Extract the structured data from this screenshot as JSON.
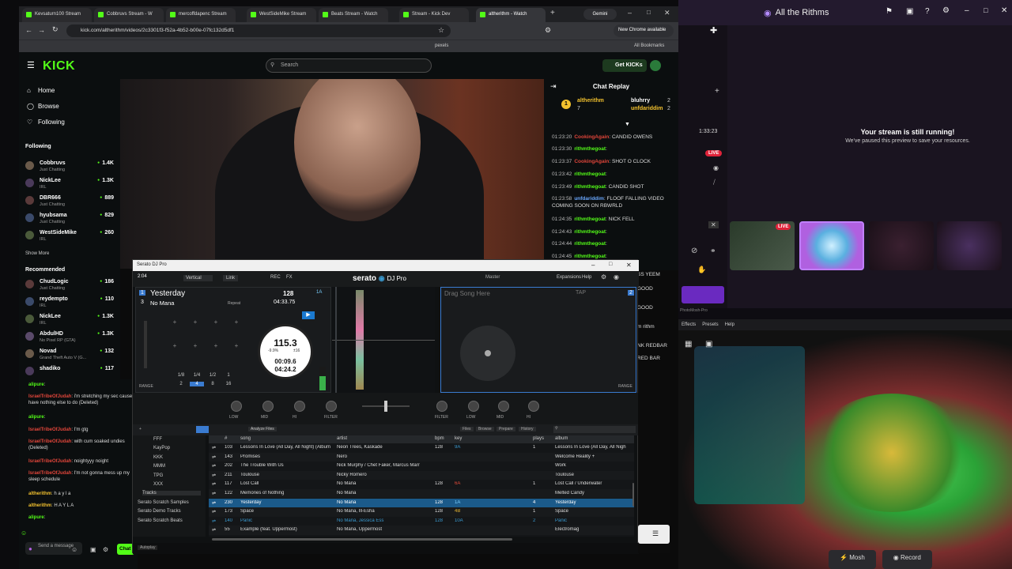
{
  "browser": {
    "tabs": [
      "Kevsaturn100 Stream",
      "Cobbruvs Stream - W",
      "mercoffdapenc Stream",
      "WestSideMike Stream",
      "Beats Stream - Watch",
      "Stream - Kick Dev",
      "altherithm - Watch"
    ],
    "gemini": "Gemini",
    "url": "kick.com/altherithm/videos/2c3301f3-f52a-4b52-b00e-07fc132d5df1",
    "new_chrome": "New Chrome available",
    "all_bookmarks": "All Bookmarks",
    "bm_pexels": "pexels"
  },
  "kick": {
    "logo": "KICK",
    "search_placeholder": "Search",
    "get_kicks": "Get KICKs",
    "nav": {
      "home": "Home",
      "browse": "Browse",
      "following": "Following"
    },
    "following_title": "Following",
    "following": [
      {
        "name": "Cobbruvs",
        "cat": "Just Chatting",
        "viewers": "1.4K"
      },
      {
        "name": "NickLee",
        "cat": "IRL",
        "viewers": "1.3K"
      },
      {
        "name": "DBR666",
        "cat": "Just Chatting",
        "viewers": "889"
      },
      {
        "name": "hyubsama",
        "cat": "Just Chatting",
        "viewers": "829"
      },
      {
        "name": "WestSideMike",
        "cat": "IRL",
        "viewers": "260"
      }
    ],
    "show_more": "Show More",
    "recommended_title": "Recommended",
    "recommended": [
      {
        "name": "ChudLogic",
        "cat": "Just Chatting",
        "viewers": "186"
      },
      {
        "name": "reydempto",
        "cat": "IRL",
        "viewers": "110"
      },
      {
        "name": "NickLee",
        "cat": "IRL",
        "viewers": "1.3K"
      },
      {
        "name": "AbdulHD",
        "cat": "No Pixel RP (GTA)",
        "viewers": "1.3K"
      },
      {
        "name": "Novad",
        "cat": "Grand Theft Auto V (G...",
        "viewers": "132"
      },
      {
        "name": "shadiko",
        "cat": "",
        "viewers": "117"
      }
    ],
    "chat_replay_title": "Chat Replay",
    "pinned": {
      "rank": "1",
      "user": "altherithm",
      "count": "7",
      "user2": "bluhrry",
      "count2": "2",
      "user3": "unfdariddim",
      "count3": "2"
    },
    "chat": [
      {
        "ts": "01:23:20",
        "user": "CookingAgain",
        "color": "#e0453a",
        "text": ": CANDID OWENS"
      },
      {
        "ts": "01:23:30",
        "user": "rithmthegoat",
        "color": "#53fc18",
        "text": ":"
      },
      {
        "ts": "01:23:37",
        "user": "CookingAgain",
        "color": "#e0453a",
        "text": ": SHOT O CLOCK"
      },
      {
        "ts": "01:23:42",
        "user": "rithmthegoat",
        "color": "#53fc18",
        "text": ":"
      },
      {
        "ts": "01:23:49",
        "user": "rithmthegoat",
        "color": "#53fc18",
        "text": ": CANDID SHOT"
      },
      {
        "ts": "01:23:58",
        "user": "unfdariddim",
        "color": "#6aa8ff",
        "text": ": FLOOF FALLING VIDEO COMING SOON ON RBWRLD"
      },
      {
        "ts": "01:24:35",
        "user": "rithmthegoat",
        "color": "#53fc18",
        "text": ": NICK FELL"
      },
      {
        "ts": "01:24:43",
        "user": "rithmthegoat",
        "color": "#53fc18",
        "text": ":"
      },
      {
        "ts": "01:24:44",
        "user": "rithmthegoat",
        "color": "#53fc18",
        "text": ":"
      },
      {
        "ts": "01:24:45",
        "user": "rithmthegoat",
        "color": "#53fc18",
        "text": ":"
      }
    ],
    "chat_overflow": [
      "SS YEEM",
      "GOOD",
      "GOOD",
      "m rithm",
      "NK REDBAR",
      "RED BAR"
    ],
    "chat2": [
      {
        "user": "alipure",
        "color": "#53fc18",
        "text": ":"
      },
      {
        "user": "IsraelTribeOfJudah",
        "color": "#e0453a",
        "text": ": i'm stretching my sec cause I have nothing else to do (Deleted)"
      },
      {
        "user": "alipure",
        "color": "#53fc18",
        "text": ":"
      },
      {
        "user": "IsraelTribeOfJudah",
        "color": "#e0453a",
        "text": ": I'm gtg"
      },
      {
        "user": "IsraelTribeOfJudah",
        "color": "#e0453a",
        "text": ": with cum soaked undies (Deleted)"
      },
      {
        "user": "IsraelTribeOfJudah",
        "color": "#e0453a",
        "text": ": noightyyy noight"
      },
      {
        "user": "IsraelTribeOfJudah",
        "color": "#e0453a",
        "text": ": I'm not gonna mess up my sleep schedule"
      },
      {
        "user": "altherithm",
        "color": "#f2c12e",
        "text": ": h a y l a"
      },
      {
        "user": "altherithm",
        "color": "#f2c12e",
        "text": ": H A Y L A"
      },
      {
        "user": "alipure",
        "color": "#53fc18",
        "text": ":"
      }
    ],
    "send_placeholder": "Send a message",
    "chat_button": "Chat"
  },
  "right_app": {
    "title": "All the Rithms",
    "timer": "1:33:23",
    "live": "LIVE",
    "still_running": "Your stream is still running!",
    "paused": "We've paused this preview to save your resources.",
    "live2": "LIVE",
    "pm_title": "PhotoMosh-Pro",
    "pm_menu": [
      "Effects",
      "Presets",
      "Help"
    ],
    "mosh_btn": "Mosh",
    "record_btn": "Record"
  },
  "serato": {
    "title": "Serato DJ Pro",
    "time": "2:04",
    "vertical": "Vertical",
    "link": "Link",
    "logo": "serato",
    "logo2": "DJ Pro",
    "master": "Master",
    "expansions": "Expansions",
    "help": "Help",
    "deckA": {
      "num": "1",
      "title": "Yesterday",
      "num2": "3",
      "artist": "No Mana",
      "bpm": "128",
      "key": "1A",
      "remaining": "04:33.75",
      "repeat": "Repeat",
      "platter_bpm": "115.3",
      "pitch": "-9.9%",
      "range": "±16",
      "elapsed": "00:09.6",
      "left": "04:24.2",
      "loops": [
        "1/8",
        "1/4",
        "1/2",
        "1",
        "2",
        "4",
        "8",
        "16"
      ],
      "range_label": "RANGE"
    },
    "deckB": {
      "num": "2",
      "drag": "Drag Song Here",
      "tap": "TAP",
      "range_label": "RANGE"
    },
    "mixer": [
      "LOW",
      "MID",
      "HI",
      "FILTER",
      "FILTER",
      "LOW",
      "MID",
      "HI"
    ],
    "analyze": "Analyze Files",
    "lib_tabs": [
      "Files",
      "Browse",
      "Prepare",
      "History"
    ],
    "crates": [
      {
        "name": "FFF",
        "cls": "sub"
      },
      {
        "name": "KayPop",
        "cls": "sub"
      },
      {
        "name": "KKK",
        "cls": "sub"
      },
      {
        "name": "MMM",
        "cls": "sub"
      },
      {
        "name": "TPG",
        "cls": "sub"
      },
      {
        "name": "XXX",
        "cls": "sub"
      },
      {
        "name": "Tracks",
        "cls": ""
      },
      {
        "name": "Serato Scratch Samples",
        "cls": "big"
      },
      {
        "name": "Serato Demo Tracks",
        "cls": "big"
      },
      {
        "name": "Serato Scratch Beats",
        "cls": "big"
      }
    ],
    "columns": [
      "#",
      "song",
      "artist",
      "bpm",
      "key",
      "plays",
      "album"
    ],
    "tracks": [
      {
        "n": "103",
        "song": "Lessons In Love (All Day, All Night) (Album",
        "artist": "Neon Trees, Kaskade",
        "bpm": "128",
        "key": "9A",
        "keycolor": "#3a9ad0",
        "plays": "1",
        "album": "Lessons In Love (All Day, All Nigh",
        "sel": false
      },
      {
        "n": "143",
        "song": "Promises",
        "artist": "Nero",
        "bpm": "",
        "key": "",
        "keycolor": "#ddd",
        "plays": "",
        "album": "Welcome Reality +",
        "sel": false
      },
      {
        "n": "202",
        "song": "The Trouble With Us",
        "artist": "Nick Murphy / Chet Faker, Marcus Marr",
        "bpm": "",
        "key": "",
        "keycolor": "#ddd",
        "plays": "",
        "album": "Work",
        "sel": false
      },
      {
        "n": "211",
        "song": "Toulouse",
        "artist": "Nicky Romero",
        "bpm": "",
        "key": "",
        "keycolor": "#ddd",
        "plays": "",
        "album": "Toulouse",
        "sel": false
      },
      {
        "n": "117",
        "song": "Lost Call",
        "artist": "No Mana",
        "bpm": "128",
        "key": "6A",
        "keycolor": "#e04a3a",
        "plays": "1",
        "album": "Lost Call / Underwater",
        "sel": false
      },
      {
        "n": "122",
        "song": "Memories of Nothing",
        "artist": "No Mana",
        "bpm": "",
        "key": "",
        "keycolor": "#ddd",
        "plays": "",
        "album": "Melted Candy",
        "sel": false
      },
      {
        "n": "230",
        "song": "Yesterday",
        "artist": "No Mana",
        "bpm": "128",
        "key": "1A",
        "keycolor": "#7ad0ff",
        "plays": "4",
        "album": "Yesterday",
        "sel": true
      },
      {
        "n": "173",
        "song": "Space",
        "artist": "No Mana, Ill-Esha",
        "bpm": "128",
        "key": "4B",
        "keycolor": "#e0b030",
        "plays": "1",
        "album": "Space",
        "sel": false
      },
      {
        "n": "140",
        "song": "Panic",
        "artist": "No Mana, Jessica Ess",
        "bpm": "128",
        "key": "10A",
        "keycolor": "#3a9ad0",
        "plays": "2",
        "album": "Panic",
        "sel": false,
        "blue": true
      },
      {
        "n": "55",
        "song": "Example (feat. Uppermost)",
        "artist": "No Mana, Uppermost",
        "bpm": "",
        "key": "",
        "keycolor": "#ddd",
        "plays": "",
        "album": "Electromag",
        "sel": false
      }
    ],
    "autoplay": "Autoplay"
  },
  "colors": {
    "kick_green": "#53fc18",
    "serato_blue": "#1b5a8a"
  }
}
